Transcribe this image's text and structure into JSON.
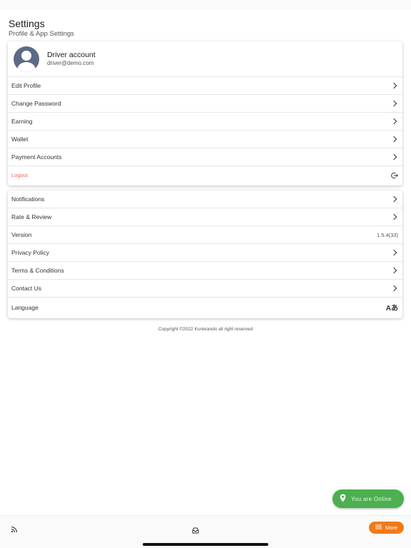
{
  "header": {
    "title": "Settings",
    "subtitle": "Profile & App Settings"
  },
  "profile": {
    "name": "Driver account",
    "email": "driver@demo.com",
    "avatar_icon": "user-avatar-icon"
  },
  "account_menu": [
    {
      "label": "Edit Profile",
      "icon": "chevron-right-icon"
    },
    {
      "label": "Change Password",
      "icon": "chevron-right-icon"
    },
    {
      "label": "Earning",
      "icon": "chevron-right-icon"
    },
    {
      "label": "Wallet",
      "icon": "chevron-right-icon"
    },
    {
      "label": "Payment Accounts",
      "icon": "chevron-right-icon"
    },
    {
      "label": "Logout",
      "icon": "logout-icon"
    }
  ],
  "app_menu": [
    {
      "label": "Notifications",
      "icon": "chevron-right-icon"
    },
    {
      "label": "Rate & Review",
      "icon": "chevron-right-icon"
    },
    {
      "label": "Version",
      "value": "1.5.4(33)"
    },
    {
      "label": "Privacy Policy",
      "icon": "chevron-right-icon"
    },
    {
      "label": "Terms & Conditions",
      "icon": "chevron-right-icon"
    },
    {
      "label": "Contact Us",
      "icon": "chevron-right-icon"
    },
    {
      "label": "Language",
      "icon_text": "Aあ"
    }
  ],
  "footer": {
    "copyright": "Copyright ©2022 Kurierando all right reserved"
  },
  "status_button": {
    "label": "You are Online",
    "icon": "location-pin-icon"
  },
  "bottom_nav": {
    "more_label": "More",
    "icons": [
      "rss-icon",
      "inbox-icon",
      "menu-icon"
    ]
  },
  "colors": {
    "online": "#4caf50",
    "more": "#f07a1a",
    "logout": "#e56a4a",
    "avatar": "#5c6b85"
  }
}
